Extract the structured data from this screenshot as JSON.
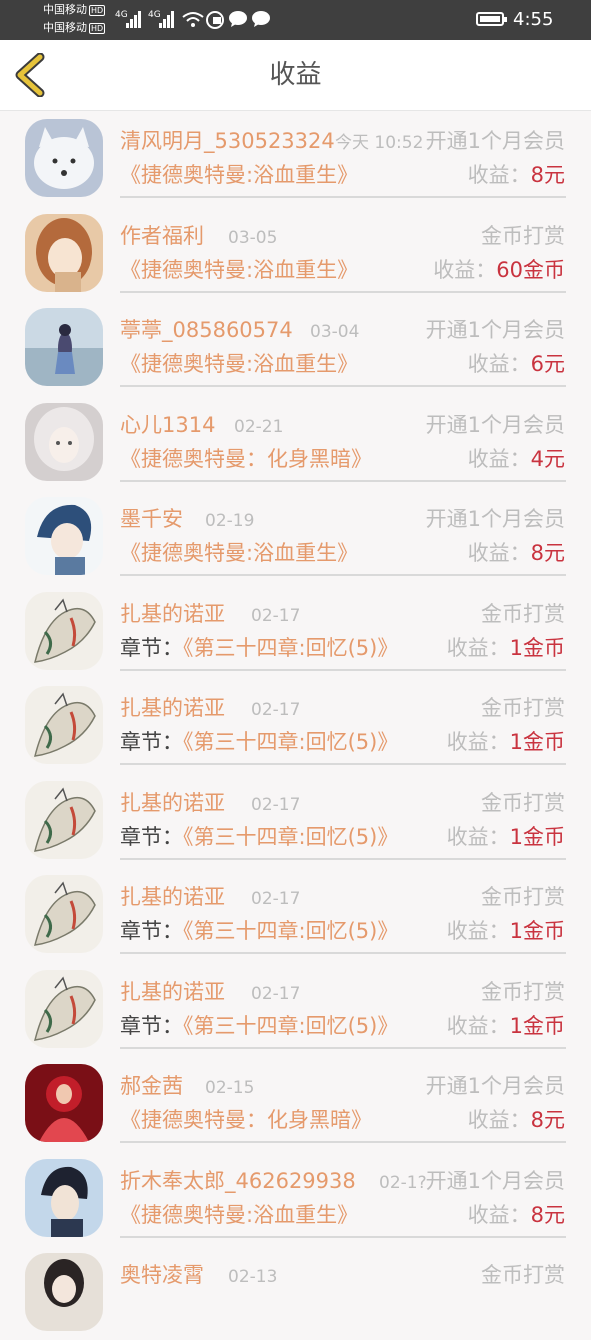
{
  "status_bar": {
    "carrier1": "中国移动",
    "carrier2": "中国移动",
    "hd": "HD",
    "net1": "4G",
    "net2": "4G",
    "time": "4:55"
  },
  "header": {
    "title": "收益"
  },
  "labels": {
    "income": "收益：",
    "chapter_prefix": "章节："
  },
  "colors": {
    "name": "#e59a6c",
    "value": "#c9333f",
    "muted": "#bdbdbd",
    "back_icon": "#e6c33a"
  },
  "rows": [
    {
      "name": "清风明月_530523324",
      "date": "今天 10:52",
      "type": "开通1个月会员",
      "book": "《捷德奥特曼:浴血重生》",
      "value": "8元",
      "avatar": "white-fox"
    },
    {
      "name": "作者福利",
      "date": "03-05",
      "type": "金币打赏",
      "book": "《捷德奥特曼:浴血重生》",
      "value": "60金币",
      "avatar": "anime-girl-orange"
    },
    {
      "name": "葶葶_085860574",
      "date": "03-04",
      "type": "开通1个月会员",
      "book": "《捷德奥特曼:浴血重生》",
      "value": "6元",
      "avatar": "girl-on-beach"
    },
    {
      "name": "心儿1314",
      "date": "02-21",
      "type": "开通1个月会员",
      "book": "《捷德奥特曼：化身黑暗》",
      "value": "4元",
      "avatar": "white-hair-girl"
    },
    {
      "name": "墨千安",
      "date": "02-19",
      "type": "开通1个月会员",
      "book": "《捷德奥特曼:浴血重生》",
      "value": "8元",
      "avatar": "blue-hair-boy"
    },
    {
      "name": "扎基的诺亚",
      "date": "02-17",
      "type": "金币打赏",
      "prefix": "章节：",
      "book": "《第三十四章:回忆(5)》",
      "value": "1金币",
      "avatar": "sketch-dragon"
    },
    {
      "name": "扎基的诺亚",
      "date": "02-17",
      "type": "金币打赏",
      "prefix": "章节：",
      "book": "《第三十四章:回忆(5)》",
      "value": "1金币",
      "avatar": "sketch-dragon"
    },
    {
      "name": "扎基的诺亚",
      "date": "02-17",
      "type": "金币打赏",
      "prefix": "章节：",
      "book": "《第三十四章:回忆(5)》",
      "value": "1金币",
      "avatar": "sketch-dragon"
    },
    {
      "name": "扎基的诺亚",
      "date": "02-17",
      "type": "金币打赏",
      "prefix": "章节：",
      "book": "《第三十四章:回忆(5)》",
      "value": "1金币",
      "avatar": "sketch-dragon"
    },
    {
      "name": "扎基的诺亚",
      "date": "02-17",
      "type": "金币打赏",
      "prefix": "章节：",
      "book": "《第三十四章:回忆(5)》",
      "value": "1金币",
      "avatar": "sketch-dragon"
    },
    {
      "name": "郝金茜",
      "date": "02-15",
      "type": "开通1个月会员",
      "book": "《捷德奥特曼：化身黑暗》",
      "value": "8元",
      "avatar": "red-art"
    },
    {
      "name": "折木奉太郎_462629938",
      "date": "02-1?",
      "type": "开通1个月会员",
      "book": "《捷德奥特曼:浴血重生》",
      "value": "8元",
      "avatar": "dark-hair-boy"
    },
    {
      "name": "奥特凌霄",
      "date": "02-13",
      "type": "金币打赏",
      "book": "",
      "value": "",
      "avatar": "partial-girl"
    }
  ]
}
